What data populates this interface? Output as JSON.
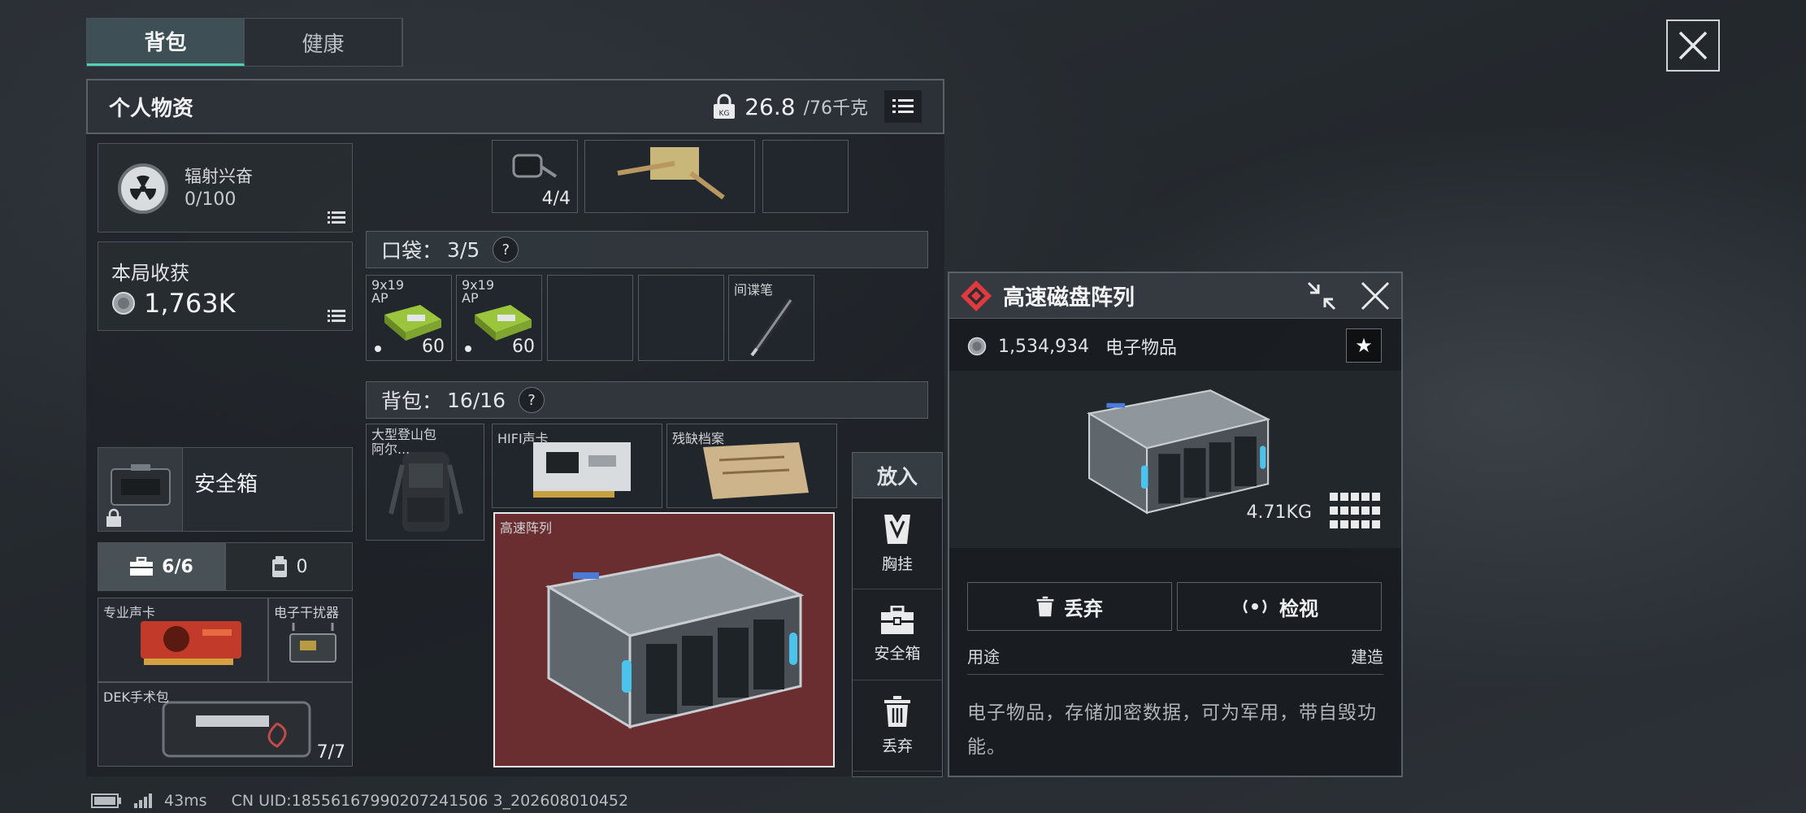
{
  "tabs": [
    {
      "label": "背包",
      "active": true
    },
    {
      "label": "健康",
      "active": false
    }
  ],
  "inventory": {
    "title": "个人物资",
    "weight_current": "26.8",
    "weight_max": "/76千克"
  },
  "radiation": {
    "label": "辐射兴奋",
    "value": "0/100"
  },
  "harvest": {
    "label": "本局收获",
    "value": "1,763K"
  },
  "safebox": {
    "label": "安全箱"
  },
  "subtabs": [
    {
      "label": "6/6",
      "icon": "toolbox-icon",
      "active": true
    },
    {
      "label": "0",
      "icon": "canister-icon",
      "active": false
    }
  ],
  "safe_items": [
    {
      "label": "专业声卡"
    },
    {
      "label": "电子干扰器"
    },
    {
      "label": "DEK手术包",
      "count": "7/7"
    }
  ],
  "top_items": [
    {
      "label": "",
      "count": "4/4"
    },
    {
      "label": ""
    },
    {
      "label": ""
    }
  ],
  "pocket": {
    "label": "口袋：",
    "count": "3/5",
    "help": "?",
    "items": [
      {
        "label": "9x19 AP",
        "count": "60"
      },
      {
        "label": "9x19 AP",
        "count": "60"
      },
      {
        "label": ""
      },
      {
        "label": ""
      },
      {
        "label": "间谍笔"
      }
    ]
  },
  "backpack": {
    "label": "背包：",
    "count": "16/16",
    "help": "?",
    "items": [
      {
        "label": "大型登山包 阿尔..."
      },
      {
        "label": "HIFI声卡"
      },
      {
        "label": "残缺档案"
      },
      {
        "label": "高速阵列"
      }
    ]
  },
  "put_panel": {
    "title": "放入",
    "options": [
      {
        "label": "胸挂",
        "icon": "vest-icon"
      },
      {
        "label": "安全箱",
        "icon": "safebox-icon"
      },
      {
        "label": "丢弃",
        "icon": "trash-icon"
      }
    ]
  },
  "detail": {
    "name": "高速磁盘阵列",
    "price": "1,534,934",
    "category": "电子物品",
    "weight": "4.71KG",
    "discard_label": "丢弃",
    "inspect_label": "检视",
    "usage_label": "用途",
    "usage_value": "建造",
    "description": "电子物品，存储加密数据，可为军用，带自毁功能。",
    "star": "★"
  },
  "status": {
    "ping": "43ms",
    "uid": "CN UID:18556167990207241506 3_202608010452"
  },
  "colors": {
    "accent": "#4fd1b7",
    "selected_slot": "#6a2d30",
    "rarity_red": "#e0393e"
  }
}
